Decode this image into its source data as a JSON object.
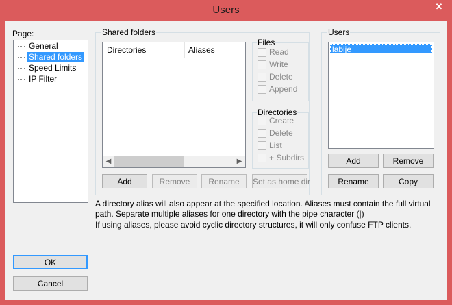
{
  "window": {
    "title": "Users",
    "close_glyph": "✕"
  },
  "page_nav": {
    "label": "Page:",
    "items": [
      "General",
      "Shared folders",
      "Speed Limits",
      "IP Filter"
    ],
    "selected": "Shared folders"
  },
  "shared_folders": {
    "group_label": "Shared folders",
    "columns": [
      "Directories",
      "Aliases"
    ],
    "rows": [],
    "buttons": {
      "add": "Add",
      "remove": "Remove",
      "rename": "Rename",
      "set_home": "Set as home dir"
    }
  },
  "files": {
    "label": "Files",
    "options": [
      "Read",
      "Write",
      "Delete",
      "Append"
    ]
  },
  "directories": {
    "label": "Directories",
    "options": [
      "Create",
      "Delete",
      "List",
      "+ Subdirs"
    ]
  },
  "users": {
    "label": "Users",
    "items": [
      "labije"
    ],
    "buttons": {
      "add": "Add",
      "remove": "Remove",
      "rename": "Rename",
      "copy": "Copy"
    }
  },
  "info": {
    "line1": "A directory alias will also appear at the specified location. Aliases must contain the full virtual",
    "line2": "path. Separate multiple aliases for one directory with the pipe character (|)",
    "line3": "If using aliases, please avoid cyclic directory structures, it will only confuse FTP clients."
  },
  "dialog_buttons": {
    "ok": "OK",
    "cancel": "Cancel"
  }
}
